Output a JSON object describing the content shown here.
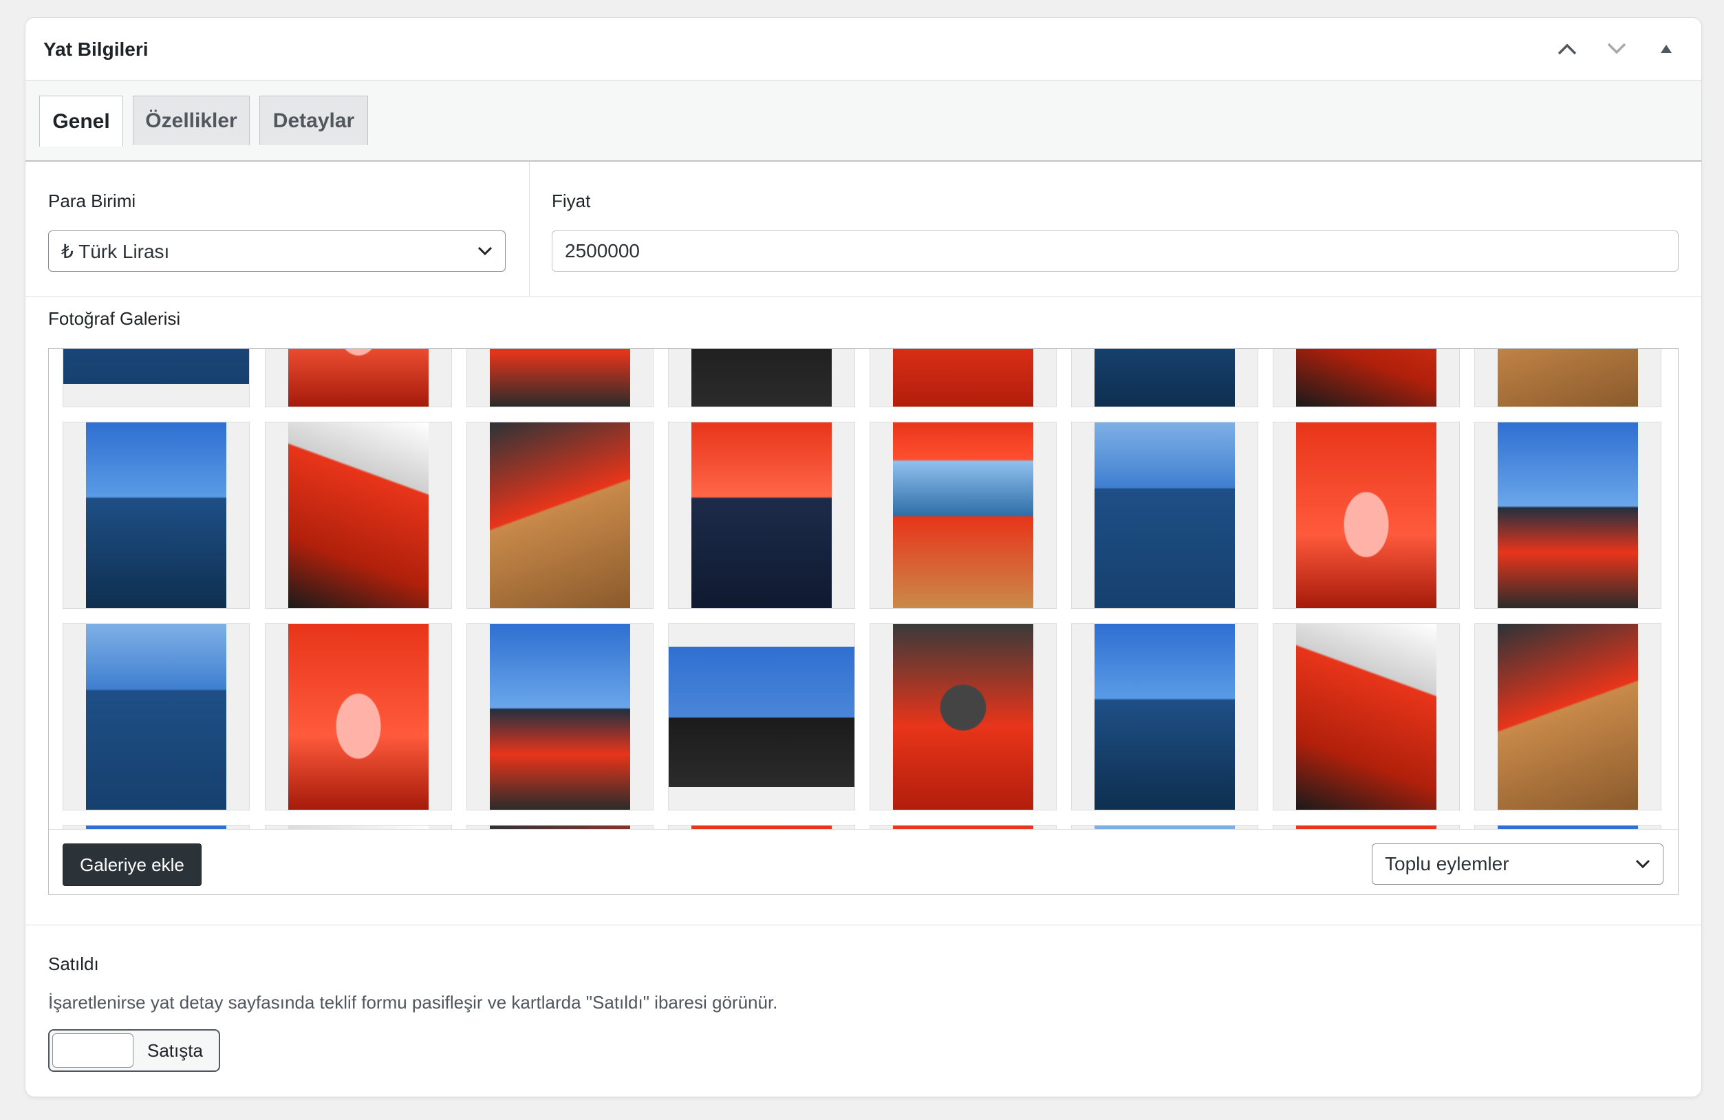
{
  "panel": {
    "title": "Yat Bilgileri",
    "controls": [
      "chevron-up-icon",
      "chevron-down-icon",
      "triangle-up-icon"
    ]
  },
  "tabs": [
    {
      "label": "Genel",
      "active": true
    },
    {
      "label": "Özellikler",
      "active": false
    },
    {
      "label": "Detaylar",
      "active": false
    }
  ],
  "currency": {
    "label": "Para Birimi",
    "selected": "₺ Türk Lirası"
  },
  "price": {
    "label": "Fiyat",
    "value": "2500000"
  },
  "gallery": {
    "label": "Fotoğraf Galerisi",
    "add_button": "Galeriye ekle",
    "bulk_actions": "Toplu eylemler"
  },
  "sold": {
    "label": "Satıldı",
    "description": "İşaretlenirse yat detay sayfasında teklif formu pasifleşir ve kartlarda \"Satıldı\" ibaresi görünür.",
    "toggle_label": "Satışta"
  },
  "colors": {
    "boat_red": "#e8351a",
    "sky_blue": "#2f6fd1",
    "sea_blue": "#1e4f86",
    "deck_teak": "#c98a4a",
    "dark": "#2c3338"
  }
}
